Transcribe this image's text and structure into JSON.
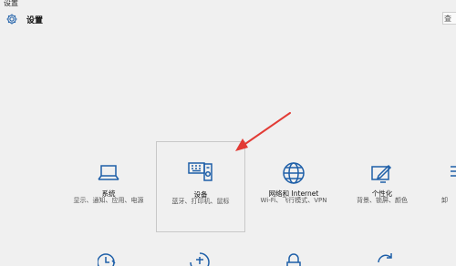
{
  "window": {
    "title": "设置"
  },
  "header": {
    "icon": "gear-icon",
    "title": "设置"
  },
  "search": {
    "placeholder": "査"
  },
  "accent_color": "#1e5fa8",
  "arrow_color": "#e23b35",
  "tiles": [
    {
      "icon": "laptop-icon",
      "title": "系统",
      "desc": "显示、通知、应用、电源"
    },
    {
      "icon": "devices-icon",
      "title": "设备",
      "desc": "蓝牙、打印机、鼠标"
    },
    {
      "icon": "globe-icon",
      "title": "网络和 Internet",
      "desc": "Wi-Fi、飞行模式、VPN"
    },
    {
      "icon": "personalize-icon",
      "title": "个性化",
      "desc": "背景、锁屏、颜色"
    },
    {
      "icon": "apps-icon",
      "title": "",
      "desc": "卸"
    }
  ],
  "bottom_icons": [
    "clock-icon",
    "ease-of-access-icon",
    "lock-icon",
    "update-icon"
  ]
}
